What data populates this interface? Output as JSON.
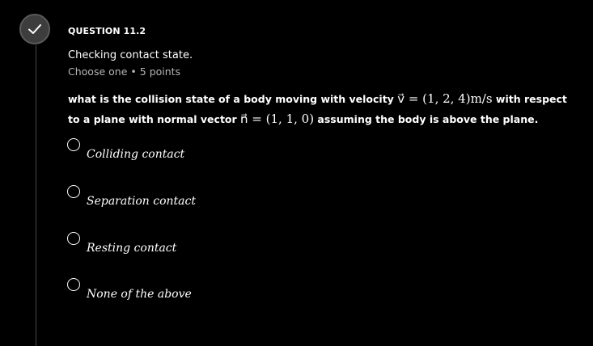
{
  "question": {
    "number_label": "QUESTION 11.2",
    "title": "Checking contact state.",
    "type_text": "Choose one",
    "points_text": "5 points",
    "body_parts": {
      "p1": "what is the collision state of a body moving with velocity",
      "velocity_math": "v⃗ = (1, 2, 4)m/s",
      "p2": "with respect  to a plane with normal  vector",
      "normal_math": "n⃗ = (1, 1, 0)",
      "p3": "assuming the body is above the plane."
    }
  },
  "options": [
    {
      "label": "Colliding contact"
    },
    {
      "label": "Separation contact"
    },
    {
      "label": "Resting contact"
    },
    {
      "label": "None of the above"
    }
  ],
  "status_icon": "check-icon",
  "colors": {
    "background": "#000000",
    "text": "#ffffff",
    "muted_text": "#b5b5b5",
    "status_circle": "#3d3d3d",
    "timeline": "#4a4a4a"
  }
}
